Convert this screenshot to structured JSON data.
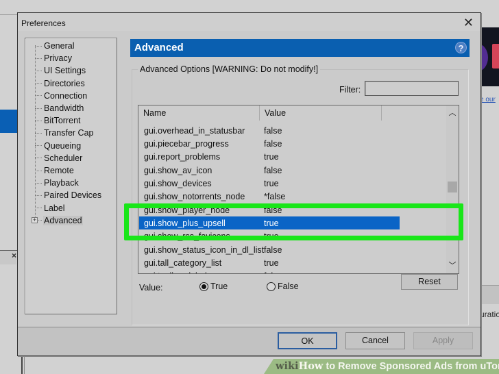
{
  "dialog": {
    "title": "Preferences",
    "close_icon": "close-icon"
  },
  "tree": {
    "items": [
      {
        "label": "General"
      },
      {
        "label": "Privacy"
      },
      {
        "label": "UI Settings"
      },
      {
        "label": "Directories"
      },
      {
        "label": "Connection"
      },
      {
        "label": "Bandwidth"
      },
      {
        "label": "BitTorrent"
      },
      {
        "label": "Transfer Cap"
      },
      {
        "label": "Queueing"
      },
      {
        "label": "Scheduler"
      },
      {
        "label": "Remote"
      },
      {
        "label": "Playback"
      },
      {
        "label": "Paired Devices"
      },
      {
        "label": "Label"
      },
      {
        "label": "Advanced",
        "selected": true,
        "expandable": true
      }
    ]
  },
  "section": {
    "title": "Advanced",
    "help_icon": "?",
    "group_label": "Advanced Options [WARNING: Do not modify!]",
    "filter_label": "Filter:",
    "filter_value": ""
  },
  "list": {
    "columns": [
      "Name",
      "Value"
    ],
    "rows": [
      {
        "name": "gui.overhead_in_statusbar",
        "value": "false"
      },
      {
        "name": "gui.piecebar_progress",
        "value": "false"
      },
      {
        "name": "gui.report_problems",
        "value": "true"
      },
      {
        "name": "gui.show_av_icon",
        "value": "false"
      },
      {
        "name": "gui.show_devices",
        "value": "true"
      },
      {
        "name": "gui.show_notorrents_node",
        "value": "*false"
      },
      {
        "name": "gui.show_player_node",
        "value": "false"
      },
      {
        "name": "gui.show_plus_upsell",
        "value": "true",
        "selected": true
      },
      {
        "name": "gui.show_rss_favicons",
        "value": "true"
      },
      {
        "name": "gui.show_status_icon_in_dl_list",
        "value": "false"
      },
      {
        "name": "gui.tall_category_list",
        "value": "true"
      },
      {
        "name": "gui.toolbar_labels",
        "value": "false"
      }
    ],
    "scroll_up": "^",
    "scroll_down": "v"
  },
  "value_editor": {
    "label": "Value:",
    "option_true": "True",
    "option_false": "False",
    "selected": "True",
    "reset_label": "Reset"
  },
  "footer": {
    "ok_label": "OK",
    "cancel_label": "Cancel",
    "apply_label": "Apply"
  },
  "background": {
    "link_text": "e our",
    "status_text": "uratio"
  },
  "watermark": {
    "wiki": "wiki",
    "how": "How",
    "title": " to Remove Sponsored Ads from uTorrent"
  },
  "colors": {
    "header_blue": "#0a5fb0",
    "selection_blue": "#0a64c6",
    "highlight_green": "#19e619"
  }
}
